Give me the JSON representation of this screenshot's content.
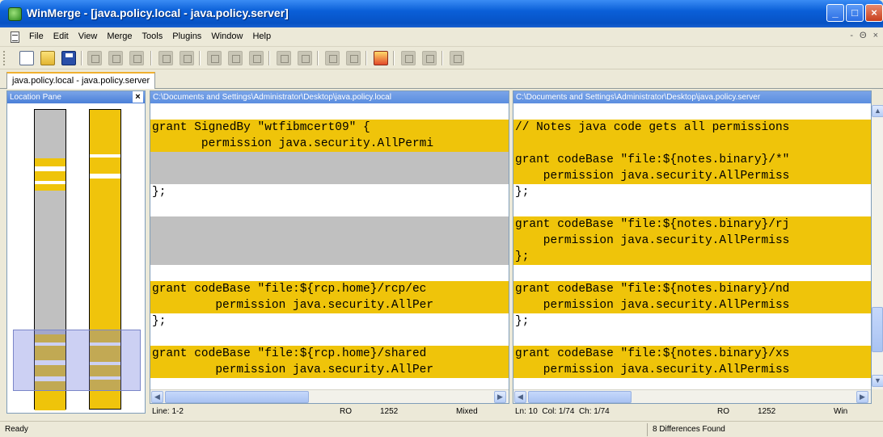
{
  "window": {
    "title": "WinMerge - [java.policy.local - java.policy.server]"
  },
  "menu": [
    "File",
    "Edit",
    "View",
    "Merge",
    "Tools",
    "Plugins",
    "Window",
    "Help"
  ],
  "mdi_controls": [
    "-",
    "Θ",
    "×"
  ],
  "window_buttons": {
    "minimize": "_",
    "maximize": "□",
    "close": "×"
  },
  "toolbar_icons": [
    "new-icon",
    "open-icon",
    "save-icon",
    "undo-icon",
    "redo-icon",
    "select-all-icon",
    "first-diff-icon",
    "prev-diff-icon",
    "next-diff-icon",
    "last-diff-icon",
    "current-diff-icon",
    "copy-left-icon",
    "copy-right-icon",
    "copy-all-left-icon",
    "copy-all-right-icon",
    "options-icon",
    "refresh-icon",
    "merge-icon",
    "sync-icon"
  ],
  "tab": {
    "label": "java.policy.local - java.policy.server"
  },
  "location_pane": {
    "title": "Location Pane",
    "close": "×"
  },
  "left_pane": {
    "path": "C:\\Documents and Settings\\Administrator\\Desktop\\java.policy.local",
    "lines": [
      {
        "text": "",
        "bg": "white"
      },
      {
        "text": "grant SignedBy \"wtfibmcert09\" {",
        "bg": "yellow"
      },
      {
        "text": "       permission java.security.AllPermi",
        "bg": "yellow"
      },
      {
        "text": "",
        "bg": "gray"
      },
      {
        "text": "",
        "bg": "gray"
      },
      {
        "text": "};",
        "bg": "white"
      },
      {
        "text": "",
        "bg": "white"
      },
      {
        "text": "",
        "bg": "gray"
      },
      {
        "text": "",
        "bg": "gray"
      },
      {
        "text": "",
        "bg": "gray"
      },
      {
        "text": "",
        "bg": "white"
      },
      {
        "text": "grant codeBase \"file:${rcp.home}/rcp/ec",
        "bg": "yellow"
      },
      {
        "text": "         permission java.security.AllPer",
        "bg": "yellow"
      },
      {
        "text": "};",
        "bg": "white"
      },
      {
        "text": "",
        "bg": "white"
      },
      {
        "text": "grant codeBase \"file:${rcp.home}/shared",
        "bg": "yellow"
      },
      {
        "text": "         permission java.security.AllPer",
        "bg": "yellow"
      }
    ],
    "status": {
      "line": "Line: 1-2",
      "ro": "RO",
      "codepage": "1252",
      "eol": "Mixed"
    }
  },
  "right_pane": {
    "path": "C:\\Documents and Settings\\Administrator\\Desktop\\java.policy.server",
    "lines": [
      {
        "text": "",
        "bg": "white"
      },
      {
        "text": "// Notes java code gets all permissions",
        "bg": "yellow"
      },
      {
        "text": "",
        "bg": "yellow"
      },
      {
        "text": "grant codeBase \"file:${notes.binary}/*\"",
        "bg": "yellow"
      },
      {
        "text": "    permission java.security.AllPermiss",
        "bg": "yellow"
      },
      {
        "text": "};",
        "bg": "white"
      },
      {
        "text": "",
        "bg": "white"
      },
      {
        "text": "grant codeBase \"file:${notes.binary}/rj",
        "bg": "yellow"
      },
      {
        "text": "    permission java.security.AllPermiss",
        "bg": "yellow"
      },
      {
        "text": "};",
        "bg": "yellow"
      },
      {
        "text": "",
        "bg": "white"
      },
      {
        "text": "grant codeBase \"file:${notes.binary}/nd",
        "bg": "yellow"
      },
      {
        "text": "    permission java.security.AllPermiss",
        "bg": "yellow"
      },
      {
        "text": "};",
        "bg": "white"
      },
      {
        "text": "",
        "bg": "white"
      },
      {
        "text": "grant codeBase \"file:${notes.binary}/xs",
        "bg": "yellow"
      },
      {
        "text": "    permission java.security.AllPermiss",
        "bg": "yellow"
      }
    ],
    "status": {
      "position": "Ln: 10  Col: 1/74  Ch: 1/74",
      "ro": "RO",
      "codepage": "1252",
      "eol": "Win"
    }
  },
  "statusbar": {
    "ready": "Ready",
    "differences": "8 Differences Found"
  },
  "colors": {
    "diff": "#efc40a",
    "missing": "#c0c0c0",
    "header": "#5b8ee0"
  }
}
